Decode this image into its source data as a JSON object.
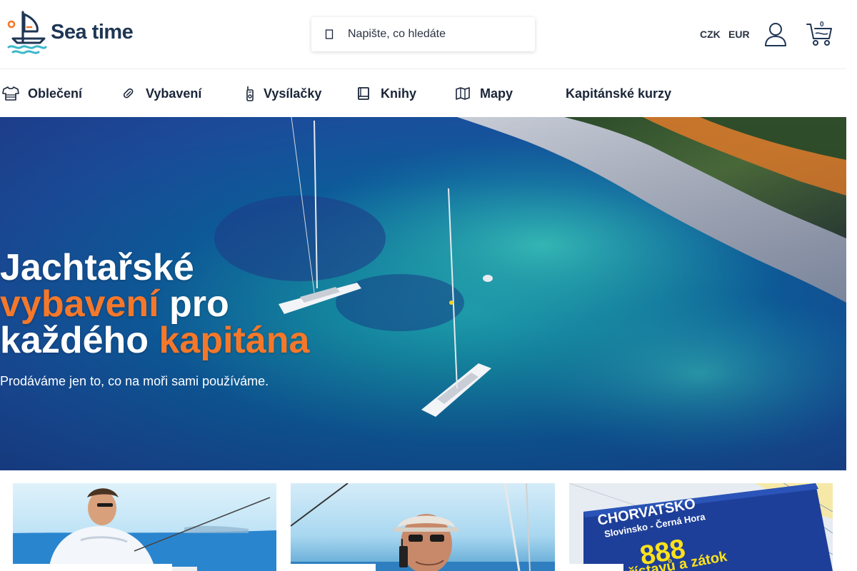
{
  "brand": {
    "name": "Sea time"
  },
  "search": {
    "placeholder": "Napište, co hledáte",
    "icon": "search-icon"
  },
  "header": {
    "currencies": [
      "CZK",
      "EUR"
    ],
    "account_icon": "user-icon",
    "cart_icon": "cart-icon",
    "cart_count": "0"
  },
  "nav": {
    "items": [
      {
        "label": "Oblečení",
        "icon": "tshirt-icon"
      },
      {
        "label": "Vybavení",
        "icon": "carabiner-icon"
      },
      {
        "label": "Vysílačky",
        "icon": "radio-icon"
      },
      {
        "label": "Knihy",
        "icon": "book-icon"
      },
      {
        "label": "Mapy",
        "icon": "map-icon"
      },
      {
        "label": "Kapitánské kurzy",
        "icon": ""
      }
    ]
  },
  "hero": {
    "line1": "Jachtařské",
    "line2_accent": "vybavení",
    "line2_rest": " pro",
    "line3_start": "každého ",
    "line3_accent": "kapitána",
    "subtitle": "Prodáváme jen to, co na moři sami používáme.",
    "accent_color": "#f5782a"
  },
  "cards": [
    {
      "image": "man-fishing-at-sea"
    },
    {
      "image": "skipper-with-radio"
    },
    {
      "image": "pilot-book-cover",
      "book_title": "CHORVATSKO",
      "book_subtitle": "Slovinsko - Černá Hora",
      "book_number": "888",
      "book_tagline": "přístavů a zátok"
    }
  ],
  "colors": {
    "brand_dark": "#1f3654",
    "accent": "#f5782a",
    "brand_teal": "#3bb8c9"
  }
}
